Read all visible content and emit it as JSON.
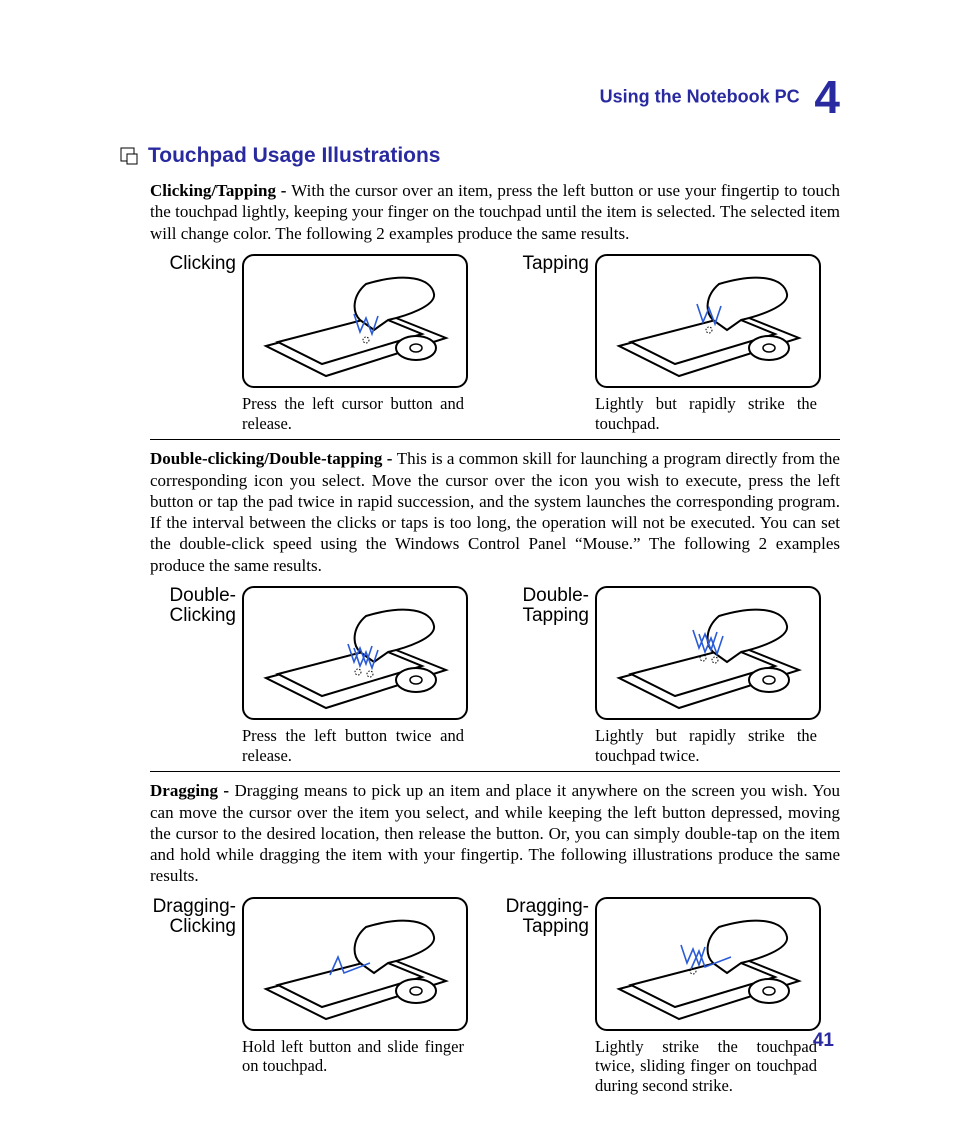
{
  "header": {
    "chapter_label": "Using the Notebook PC",
    "chapter_number": "4"
  },
  "title": "Touchpad Usage Illustrations",
  "page_number": "41",
  "sections": [
    {
      "lead": "Clicking/Tapping - ",
      "body": "With the cursor over an item, press the left button or use your fingertip to touch the touchpad lightly, keeping your finger on the touchpad until the item is selected. The selected item will change color. The following 2 examples produce the same results.",
      "left": {
        "label": "Clicking",
        "caption": "Press the left cursor button and release."
      },
      "right": {
        "label": "Tapping",
        "caption": "Lightly but rapidly strike the touchpad."
      }
    },
    {
      "lead": "Double-clicking/Double-tapping - ",
      "body": "This is a common skill for launching a program directly from the corresponding icon you select. Move the cursor over the icon you wish to execute, press the left button or tap the pad twice in rapid succession, and the system launches the corresponding program. If the interval between the clicks or taps is too long, the operation will not be executed. You can set the double-click speed using the Windows Control Panel “Mouse.” The following 2 examples produce the same results.",
      "left": {
        "label": "Double-\nClicking",
        "caption": "Press the left button twice and release."
      },
      "right": {
        "label": "Double-\nTapping",
        "caption": "Lightly but rapidly strike the touchpad twice."
      }
    },
    {
      "lead": "Dragging - ",
      "body": "Dragging means to pick up an item and place it anywhere on the screen you wish. You can move the cursor over the item you select, and while keeping the left button depressed, moving the cursor to the desired location, then release the button. Or, you can simply double-tap on the item and hold while dragging the item with your fingertip. The following illustrations produce the same results.",
      "left": {
        "label": "Dragging-\nClicking",
        "caption": "Hold left button and slide finger on touchpad."
      },
      "right": {
        "label": "Dragging-\nTapping",
        "caption": "Lightly strike the touchpad twice, sliding finger on touchpad during second strike."
      }
    }
  ]
}
